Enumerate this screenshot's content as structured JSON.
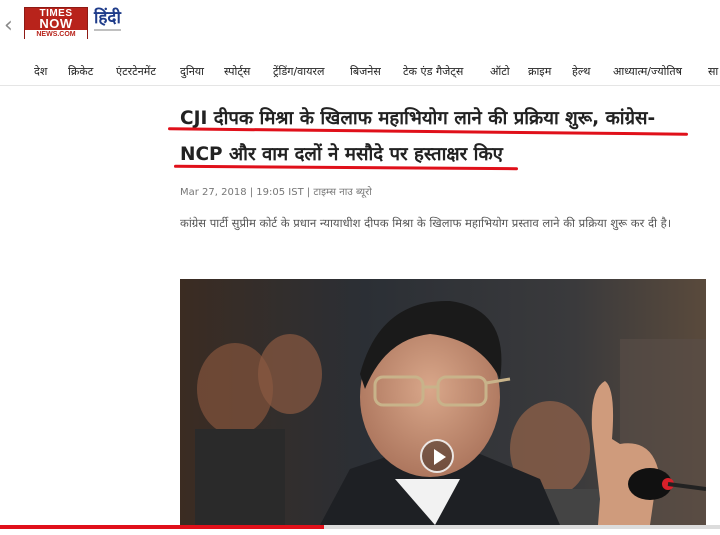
{
  "header": {
    "back_icon": "chevron-left-icon",
    "logo": {
      "line1": "TIMES",
      "line2": "NOW",
      "line3": "NEWS.COM"
    },
    "language_label": "हिंदी"
  },
  "nav": {
    "items": [
      "देश",
      "क्रिकेट",
      "एंटरटेनमेंट",
      "दुनिया",
      "स्पोर्ट्स",
      "ट्रेंडिंग/वायरल",
      "बिजनेस",
      "टेक एंड गैजेट्स",
      "ऑटो",
      "क्राइम",
      "हेल्थ",
      "आध्यात्म/ज्योतिष",
      "सा"
    ]
  },
  "article": {
    "headline_line1": "CJI दीपक मिश्रा के खिलाफ महाभियोग लाने की प्रक्रिया शुरू, कांग्रेस-",
    "headline_line2": "NCP और वाम दलों ने मसौदे पर हस्ताक्षर किए",
    "meta": "Mar 27, 2018 | 19:05 IST | टाइम्स नाउ ब्यूरो",
    "summary": "कांग्रेस पार्टी सुप्रीम कोर्ट के प्रधान न्यायाधीश दीपक मिश्रा के खिलाफ महाभियोग प्रस्ताव लाने की प्रक्रिया शुरू कर दी है।"
  },
  "video": {
    "play_icon": "play-icon",
    "progress": 0.45
  },
  "colors": {
    "brand_red": "#b8231b",
    "underline_red": "#e0101a",
    "hindi_blue": "#1f3c8a"
  }
}
